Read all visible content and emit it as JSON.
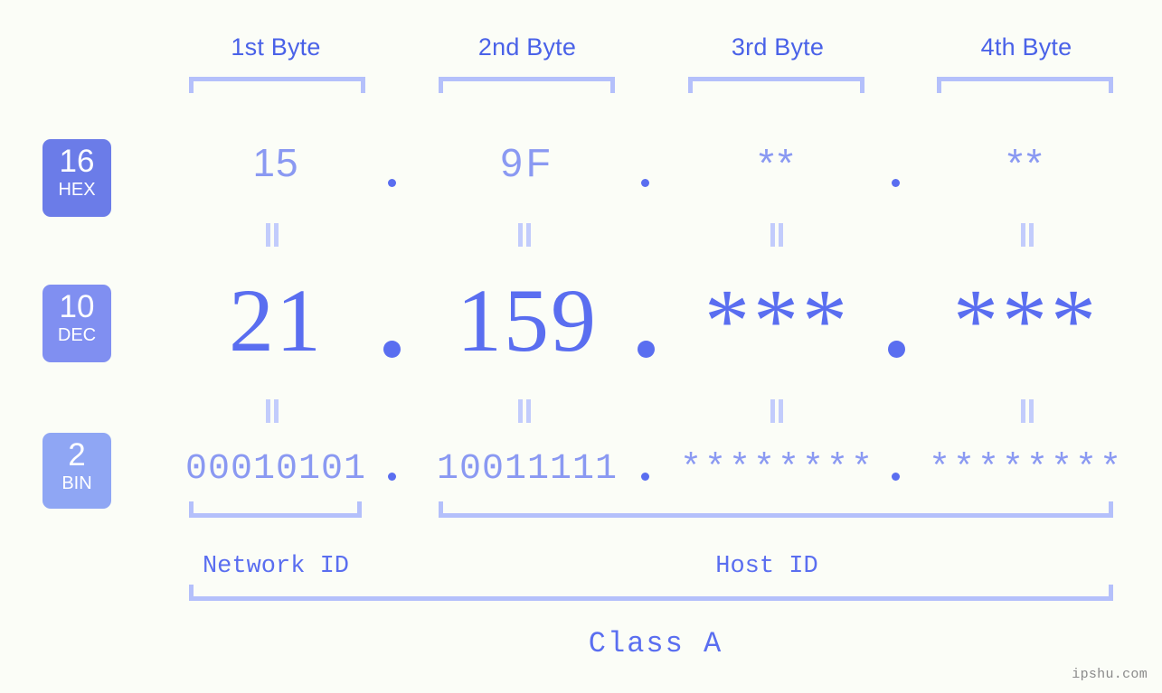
{
  "meta": {
    "background_color": "#fbfdf7",
    "accent_color": "#5a6ef0",
    "light_accent_color": "#b4c0fb",
    "watermark": "ipshu.com"
  },
  "byte_headers": [
    {
      "label": "1st Byte"
    },
    {
      "label": "2nd Byte"
    },
    {
      "label": "3rd Byte"
    },
    {
      "label": "4th Byte"
    }
  ],
  "bases": [
    {
      "number": "16",
      "name": "HEX",
      "color": "#6b7ce8"
    },
    {
      "number": "10",
      "name": "DEC",
      "color": "#808ff1"
    },
    {
      "number": "2",
      "name": "BIN",
      "color": "#8fa6f4"
    }
  ],
  "rows": {
    "hex": {
      "values": [
        "15",
        "9F",
        "**",
        "**"
      ]
    },
    "dec": {
      "values": [
        "21",
        "159",
        "***",
        "***"
      ]
    },
    "bin": {
      "values": [
        "00010101",
        "10011111",
        "********",
        "********"
      ]
    }
  },
  "separator": ".",
  "equals_symbol": "=",
  "segments": [
    {
      "label": "Network ID"
    },
    {
      "label": "Host ID"
    }
  ],
  "class_label": "Class A"
}
